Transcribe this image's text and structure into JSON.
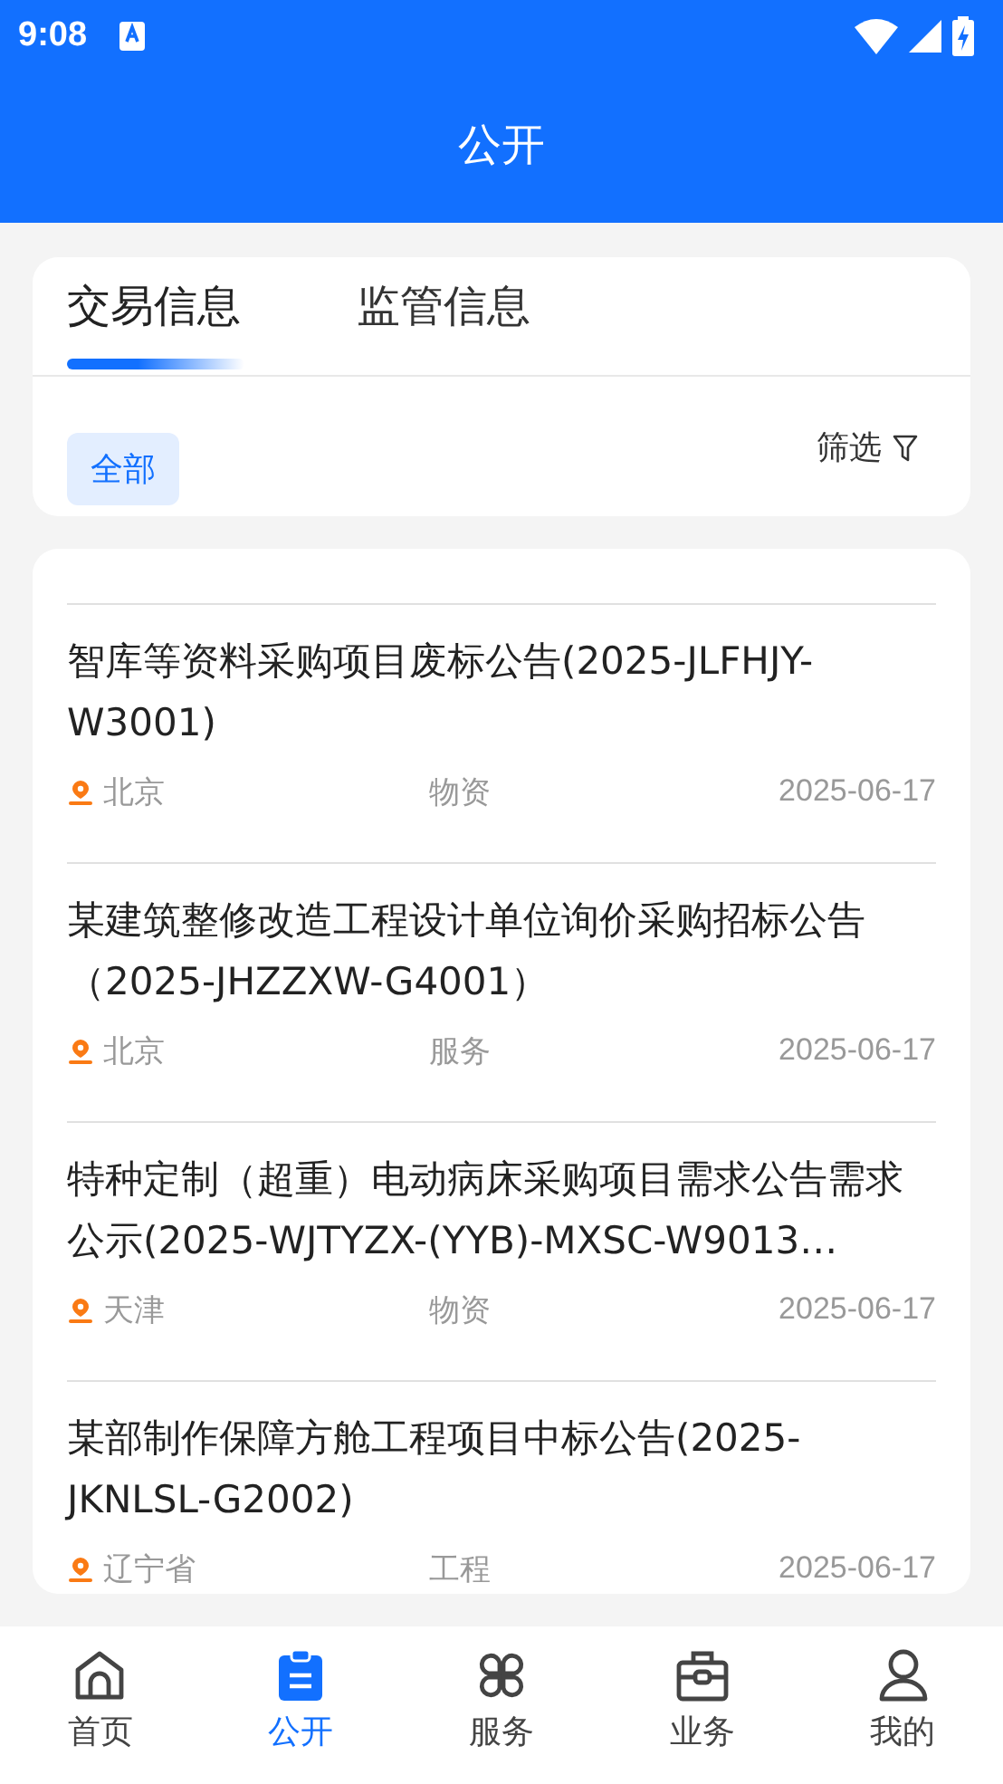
{
  "status_bar": {
    "time": "9:08"
  },
  "header": {
    "title": "公开"
  },
  "tabs": [
    {
      "label": "交易信息",
      "selected": true
    },
    {
      "label": "监管信息",
      "selected": false
    }
  ],
  "filter_chips": [
    {
      "label": "全部",
      "selected": true
    }
  ],
  "filter_button": {
    "label": "筛选"
  },
  "items": [
    {
      "title": "智库等资料采购项目废标公告(2025-JLFHJY-W3001)",
      "location": "北京",
      "category": "物资",
      "date": "2025-06-17"
    },
    {
      "title": "某建筑整修改造工程设计单位询价采购招标公告（2025-JHZZXW-G4001）",
      "location": "北京",
      "category": "服务",
      "date": "2025-06-17"
    },
    {
      "title": "特种定制（超重）电动病床采购项目需求公告需求公示(2025-WJTYZX-(YYB)-MXSC-W9013…",
      "location": "天津",
      "category": "物资",
      "date": "2025-06-17"
    },
    {
      "title": "某部制作保障方舱工程项目中标公告(2025-JKNLSL-G2002)",
      "location": "辽宁省",
      "category": "工程",
      "date": "2025-06-17"
    }
  ],
  "bottom_nav": [
    {
      "label": "首页",
      "selected": false
    },
    {
      "label": "公开",
      "selected": true
    },
    {
      "label": "服务",
      "selected": false
    },
    {
      "label": "业务",
      "selected": false
    },
    {
      "label": "我的",
      "selected": false
    }
  ]
}
